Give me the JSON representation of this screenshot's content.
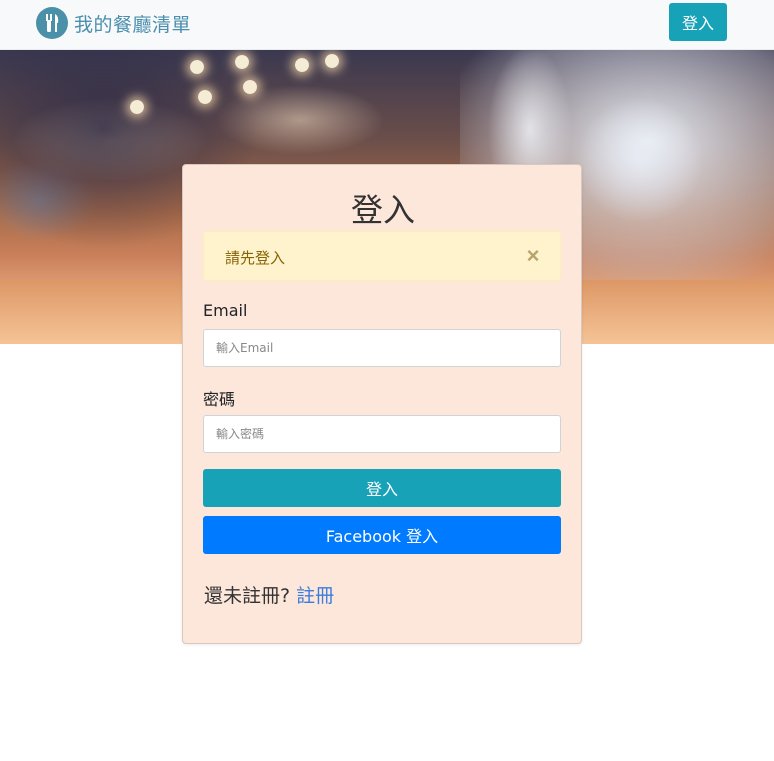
{
  "navbar": {
    "brand_icon": "utensils-icon",
    "brand_title": "我的餐廳清單",
    "login_button": "登入"
  },
  "hero": {
    "image": "blurred-restaurant-background"
  },
  "login_card": {
    "title": "登入",
    "alert": {
      "message": "請先登入",
      "close_icon": "close-icon",
      "close_symbol": "×"
    },
    "email": {
      "label": "Email",
      "placeholder": "輸入Email"
    },
    "password": {
      "label": "密碼",
      "placeholder": "輸入密碼"
    },
    "submit_button": "登入",
    "facebook_button": "Facebook 登入",
    "signup_prompt": "還未註冊?",
    "signup_link": "註冊"
  },
  "colors": {
    "accent": "#17a2b8",
    "facebook": "#007bff",
    "card_background": "#fde7da",
    "alert_background": "#fff3cd",
    "link": "#3b7ddd"
  }
}
